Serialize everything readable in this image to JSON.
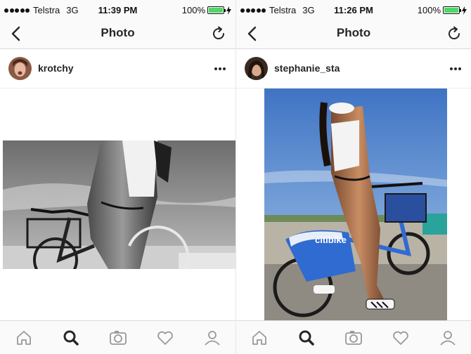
{
  "screens": [
    {
      "status": {
        "carrier": "Telstra",
        "network": "3G",
        "time": "11:39 PM",
        "battery": "100%",
        "battery_level": 1.0
      },
      "nav": {
        "title": "Photo",
        "back_icon": "chevron-left-icon",
        "refresh_icon": "refresh-icon"
      },
      "post": {
        "username": "krotchy",
        "more_icon": "ellipsis-icon"
      },
      "tabs": [
        "home-icon",
        "search-icon",
        "camera-icon",
        "heart-icon",
        "profile-icon"
      ],
      "active_tab": "search"
    },
    {
      "status": {
        "carrier": "Telstra",
        "network": "3G",
        "time": "11:26 PM",
        "battery": "100%",
        "battery_level": 1.0
      },
      "nav": {
        "title": "Photo",
        "back_icon": "chevron-left-icon",
        "refresh_icon": "refresh-icon"
      },
      "post": {
        "username": "stephanie_sta",
        "more_icon": "ellipsis-icon",
        "bike_text": "citibike"
      },
      "tabs": [
        "home-icon",
        "search-icon",
        "camera-icon",
        "heart-icon",
        "profile-icon"
      ],
      "active_tab": "search"
    }
  ],
  "colors": {
    "battery_green": "#4cd964",
    "bike_blue": "#2f6bd1",
    "sky_blue": "#5b8fd4"
  }
}
